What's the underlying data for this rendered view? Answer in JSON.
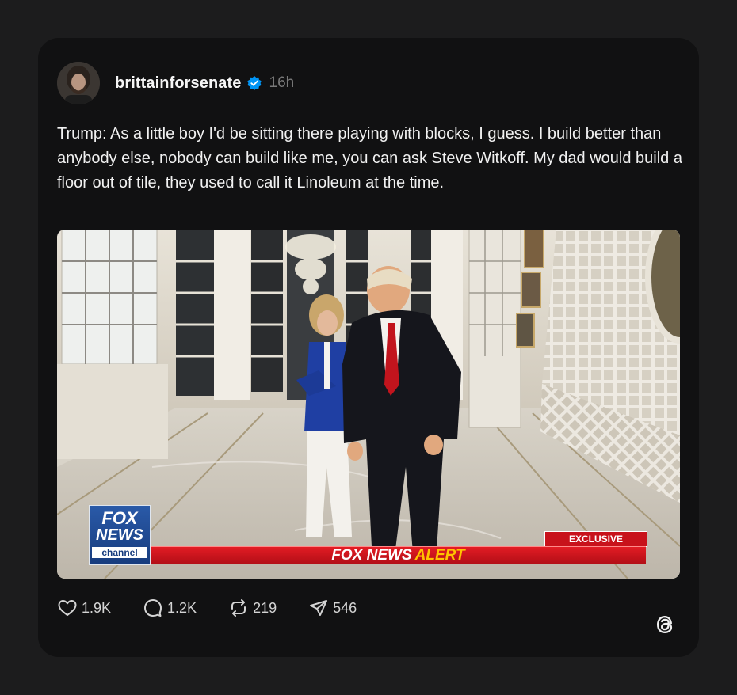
{
  "post": {
    "username": "brittainforsenate",
    "time": "16h",
    "text": "Trump: As a little boy I'd be sitting there playing with blocks, I guess. I build better than anybody else, nobody can build like me, you can ask Steve Witkoff. My dad would build a floor out of tile, they used to call it Linoleum at the time.",
    "verified_icon": "verified-badge-icon",
    "avatar_icon": "avatar"
  },
  "media": {
    "logo_line1": "FOX",
    "logo_line2": "NEWS",
    "logo_line3": "channel",
    "exclusive": "EXCLUSIVE",
    "alert_prefix": "FOX NEWS",
    "alert_word": "ALERT"
  },
  "actions": {
    "likes": "1.9K",
    "replies": "1.2K",
    "reposts": "219",
    "shares": "546"
  },
  "colors": {
    "background": "#1c1c1d",
    "card": "#111112",
    "verified": "#0095f6",
    "alert_red": "#c8121b",
    "alert_yellow": "#ffc400"
  }
}
